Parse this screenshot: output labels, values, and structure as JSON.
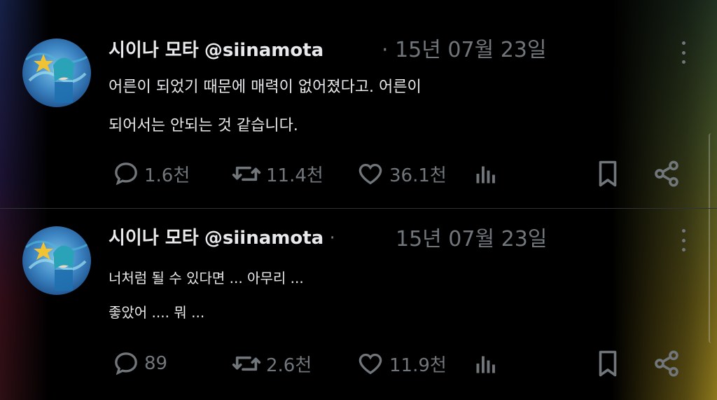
{
  "posts": [
    {
      "name": "시이나 모타",
      "handle": "@siinamota",
      "date_separator": "·",
      "date": "15년 07월 23일",
      "text_lines": [
        "어른이 되었기 때문에 매력이 없어졌다고. 어른이",
        "되어서는 안되는 것 같습니다."
      ],
      "replies": "1.6천",
      "reposts": "11.4천",
      "likes": "36.1천"
    },
    {
      "name": "시이나 모타",
      "handle": "@siinamota",
      "date_separator": "·",
      "date": "15년 07월 23일",
      "text_lines": [
        "너처럼 될 수 있다면 ... 아무리 ...",
        "좋았어 .... 뭐 ..."
      ],
      "replies": "89",
      "reposts": "2.6천",
      "likes": "11.9천"
    }
  ],
  "icons": [
    "comment-icon",
    "repost-icon",
    "heart-icon",
    "views-icon",
    "bookmark-icon",
    "share-icon",
    "more-icon"
  ],
  "colors": {
    "background": "#000000",
    "text": "#e7e9ea",
    "secondary": "#71767b",
    "divider": "#2f3336"
  }
}
